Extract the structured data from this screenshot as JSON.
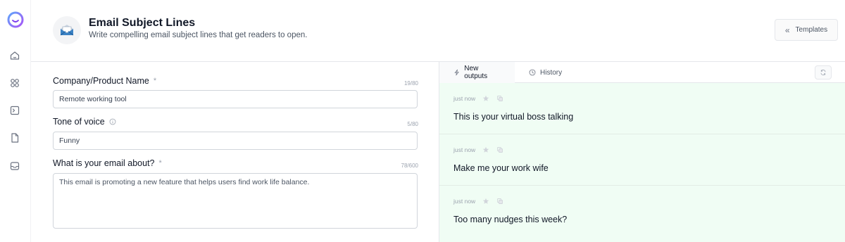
{
  "header": {
    "title": "Email Subject Lines",
    "subtitle": "Write compelling email subject lines that get readers to open.",
    "templates_label": "Templates"
  },
  "form": {
    "company": {
      "label": "Company/Product Name",
      "required_mark": "*",
      "count": "19/80",
      "value": "Remote working tool"
    },
    "tone": {
      "label": "Tone of voice",
      "count": "5/80",
      "value": "Funny"
    },
    "about": {
      "label": "What is your email about?",
      "required_mark": "*",
      "count": "78/600",
      "value": "This email is promoting a new feature that helps users find work life balance."
    }
  },
  "panel": {
    "tabs": [
      {
        "label": "New outputs",
        "icon": "lightning-icon"
      },
      {
        "label": "History",
        "icon": "clock-icon"
      }
    ],
    "outputs": [
      {
        "time": "just now",
        "text": "This is your virtual boss talking"
      },
      {
        "time": "just now",
        "text": "Make me your work wife"
      },
      {
        "time": "just now",
        "text": "Too many nudges this week?"
      }
    ]
  },
  "colors": {
    "outputs_bg": "#f0fdf4",
    "border": "#e5e7eb",
    "brand": "#8b5cf6"
  }
}
